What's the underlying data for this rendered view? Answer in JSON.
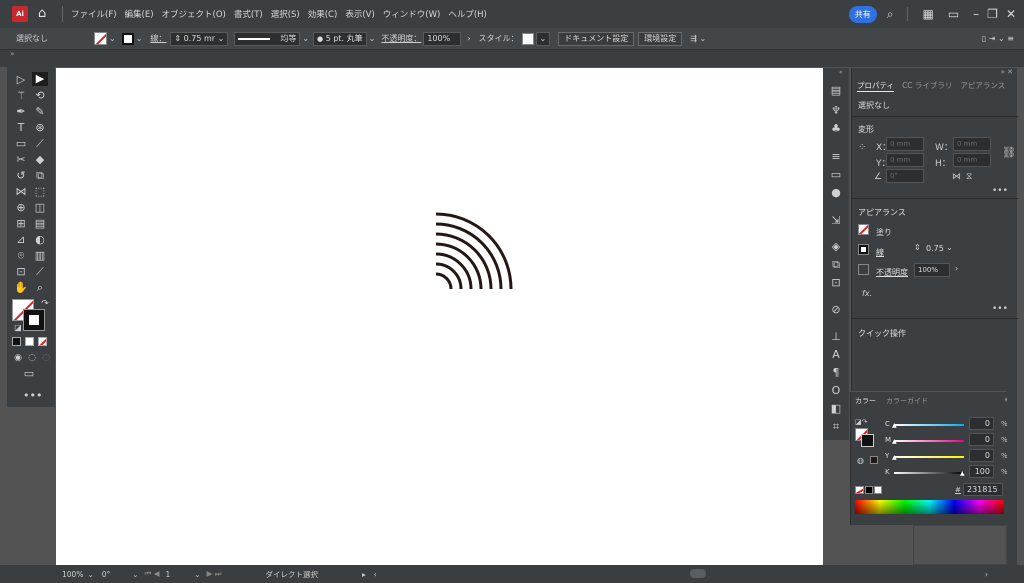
{
  "app": {
    "logo_text": "Ai"
  },
  "menu": {
    "items": [
      "ファイル(F)",
      "編集(E)",
      "オブジェクト(O)",
      "書式(T)",
      "選択(S)",
      "効果(C)",
      "表示(V)",
      "ウィンドウ(W)",
      "ヘルプ(H)"
    ],
    "share_label": "共有"
  },
  "control_bar": {
    "selection_label": "選択なし",
    "stroke_label": "線：",
    "stroke_value": "0.75 mr",
    "stroke_profile": "均等",
    "brush_value": "5 pt. 丸筆",
    "opacity_label": "不透明度：",
    "opacity_value": "100%",
    "style_label": "スタイル：",
    "doc_setup_button": "ドキュメント設定",
    "preferences_button": "環境設定"
  },
  "properties_panel": {
    "tabs": [
      "プロパティ",
      "CC ライブラリ",
      "アピアランス"
    ],
    "selection_text": "選択なし",
    "transform_title": "変形",
    "x_label": "X：",
    "y_label": "Y：",
    "w_label": "W：",
    "h_label": "H：",
    "x_value": "0 mm",
    "y_value": "0 mm",
    "w_value": "0 mm",
    "h_value": "0 mm",
    "angle_value": "0°",
    "appearance_title": "アピアランス",
    "fill_label": "塗り",
    "stroke_label": "線",
    "stroke_value": "0.75",
    "opacity_label": "不透明度",
    "opacity_value": "100%",
    "fx_label": "fx.",
    "quick_actions_title": "クイック操作"
  },
  "color_panel": {
    "tabs": [
      "カラー",
      "カラーガイド"
    ],
    "channels": [
      {
        "label": "C",
        "value": "0",
        "unit": "%"
      },
      {
        "label": "M",
        "value": "0",
        "unit": "%"
      },
      {
        "label": "Y",
        "value": "0",
        "unit": "%"
      },
      {
        "label": "K",
        "value": "100",
        "unit": "%"
      }
    ],
    "hex_label": "#",
    "hex_value": "231815"
  },
  "status_bar": {
    "zoom": "100%",
    "rotation": "0°",
    "artboard": "1",
    "tool_name": "ダイレクト選択"
  },
  "colors": {
    "accent": "#2f71e0",
    "panel_bg": "#3c3f41",
    "canvas": "#ffffff",
    "artwork": "#231815"
  }
}
